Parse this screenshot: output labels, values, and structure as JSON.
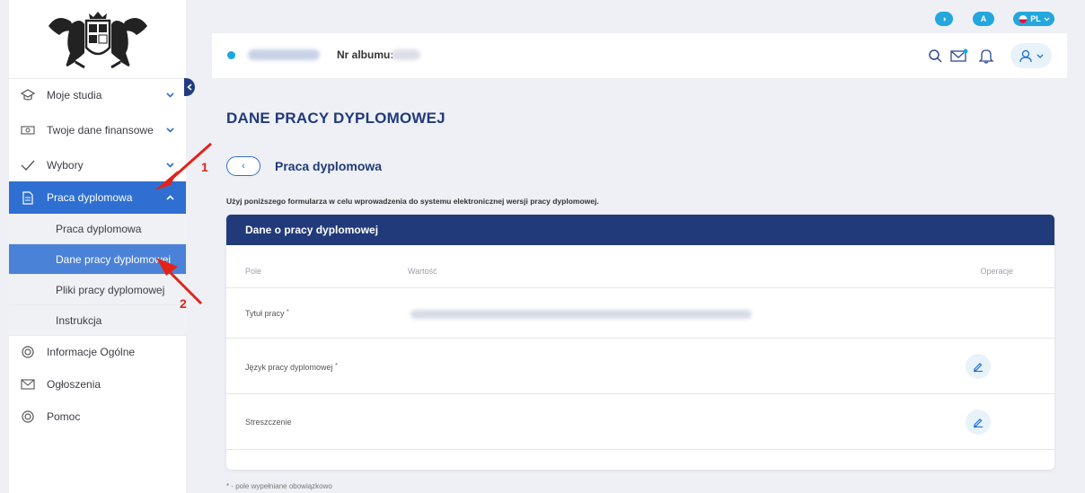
{
  "lang_pills": {
    "contrast": "◑",
    "font": "A",
    "language": "PL"
  },
  "header": {
    "album_label": "Nr albumu:"
  },
  "sidebar": {
    "items": [
      {
        "label": "Moje studia"
      },
      {
        "label": "Twoje dane finansowe"
      },
      {
        "label": "Wybory"
      },
      {
        "label": "Praca dyplomowa"
      },
      {
        "label": "Informacje Ogólne"
      },
      {
        "label": "Ogłoszenia"
      },
      {
        "label": "Pomoc"
      }
    ],
    "subitems": [
      {
        "label": "Praca dyplomowa"
      },
      {
        "label": "Dane pracy dyplomowej"
      },
      {
        "label": "Pliki pracy dyplomowej"
      },
      {
        "label": "Instrukcja"
      }
    ]
  },
  "main": {
    "title": "DANE PRACY DYPLOMOWEJ",
    "back_glyph": "‹",
    "subtitle": "Praca dyplomowa",
    "info": "Użyj poniższego formularza w celu wprowadzenia do systemu elektronicznej wersji pracy dyplomowej.",
    "card_title": "Dane o pracy dyplomowej",
    "columns": {
      "field": "Pole",
      "value": "Wartość",
      "ops": "Operacje"
    },
    "rows": [
      {
        "field": "Tytuł pracy",
        "required": "*"
      },
      {
        "field": "Język pracy dyplomowej",
        "required": "*"
      },
      {
        "field": "Streszczenie",
        "required": ""
      }
    ],
    "footnote": "* - pole wypełniane obowiązkowo"
  },
  "annotations": {
    "arrow1": "1",
    "arrow2": "2"
  },
  "colors": {
    "navy": "#213a7a",
    "accent": "#2e6fd1",
    "pill": "#23a7dd",
    "annotation": "#e2231a"
  }
}
